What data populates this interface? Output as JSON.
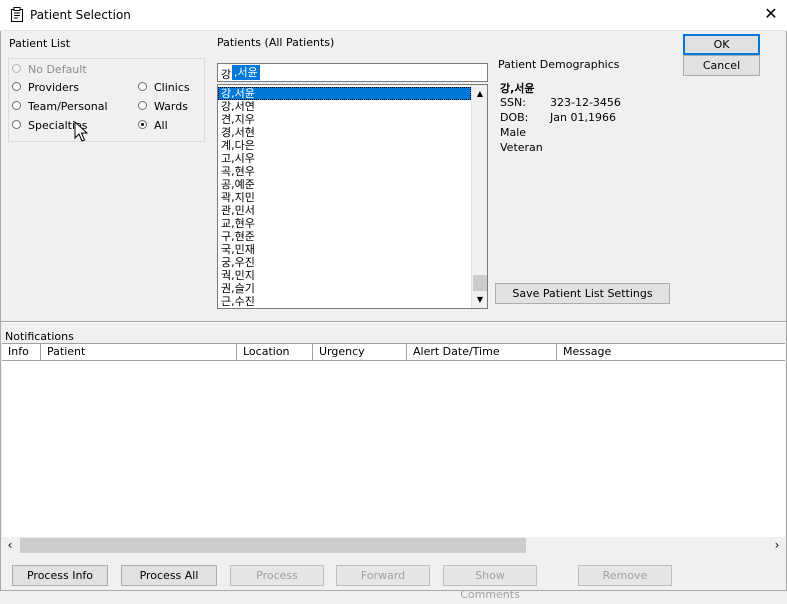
{
  "window": {
    "title": "Patient Selection",
    "close_symbol": "✕"
  },
  "patient_list": {
    "label": "Patient List",
    "options": [
      {
        "label": "No Default",
        "checked": false,
        "disabled": true
      },
      {
        "label": "Providers",
        "checked": false,
        "disabled": false
      },
      {
        "label": "Team/Personal",
        "checked": false,
        "disabled": false
      },
      {
        "label": "Specialties",
        "checked": false,
        "disabled": false
      },
      {
        "label": "Clinics",
        "checked": false,
        "disabled": false
      },
      {
        "label": "Wards",
        "checked": false,
        "disabled": false
      },
      {
        "label": "All",
        "checked": true,
        "disabled": false
      }
    ]
  },
  "patients": {
    "label": "Patients (All Patients)",
    "search_prefix": "강",
    "search_selected": ",서윤",
    "items": [
      "강,서윤",
      "강,서연",
      "견,지우",
      "경,서현",
      "계,다은",
      "고,시우",
      "곡,현우",
      "공,예준",
      "곽,지민",
      "관,민서",
      "교,현우",
      "구,현준",
      "국,민재",
      "궁,우진",
      "궉,민지",
      "권,슬기",
      "근,수진"
    ],
    "selected_index": 0
  },
  "buttons": {
    "ok": "OK",
    "cancel": "Cancel",
    "save_settings": "Save Patient List Settings"
  },
  "demographics": {
    "title": "Patient Demographics",
    "name": "강,서윤",
    "ssn_label": "SSN:",
    "ssn": "323-12-3456",
    "dob_label": "DOB:",
    "dob": "Jan 01,1966",
    "sex": "Male",
    "status": "Veteran"
  },
  "notifications": {
    "label": "Notifications",
    "columns": [
      "Info",
      "Patient",
      "Location",
      "Urgency",
      "Alert Date/Time",
      "Message"
    ]
  },
  "bottom_buttons": [
    {
      "label": "Process Info",
      "disabled": false
    },
    {
      "label": "Process All",
      "disabled": false
    },
    {
      "label": "Process",
      "disabled": true
    },
    {
      "label": "Forward",
      "disabled": true
    },
    {
      "label": "Show Comments",
      "disabled": true
    },
    {
      "label": "Remove",
      "disabled": true
    }
  ],
  "scroll_glyphs": {
    "up": "▲",
    "down": "▼",
    "left": "‹",
    "right": "›"
  }
}
